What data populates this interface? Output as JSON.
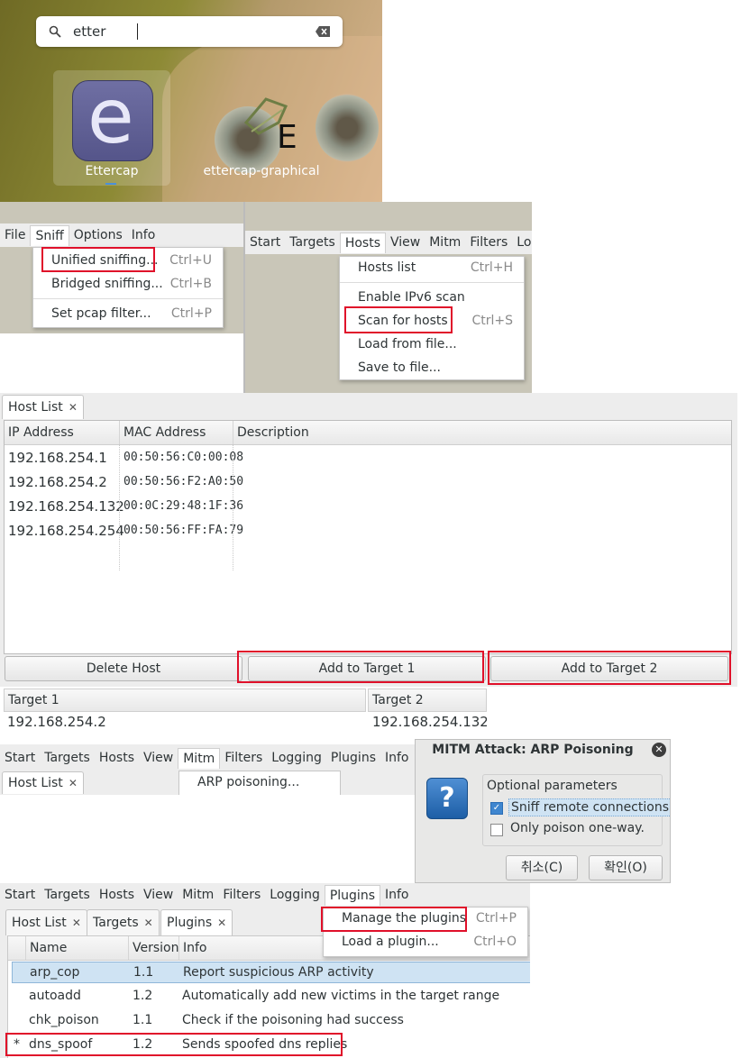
{
  "launcher": {
    "search_value": "etter",
    "apps": [
      {
        "label": "Ettercap",
        "icon": "ettercap-e-icon"
      },
      {
        "label": "ettercap-graphical",
        "icon": "terminal-cursor-icon"
      }
    ]
  },
  "sniff_panel": {
    "menubar": [
      "File",
      "Sniff",
      "Options",
      "Info"
    ],
    "items": [
      {
        "label": "Unified sniffing...",
        "accel": "Ctrl+U"
      },
      {
        "label": "Bridged sniffing...",
        "accel": "Ctrl+B"
      },
      {
        "label": "Set pcap filter...",
        "accel": "Ctrl+P"
      }
    ]
  },
  "hosts_panel": {
    "menubar": [
      "Start",
      "Targets",
      "Hosts",
      "View",
      "Mitm",
      "Filters",
      "Lo"
    ],
    "items": [
      {
        "label": "Hosts list",
        "accel": "Ctrl+H"
      },
      {
        "label": "Enable IPv6 scan",
        "accel": ""
      },
      {
        "label": "Scan for hosts",
        "accel": "Ctrl+S"
      },
      {
        "label": "Load from file...",
        "accel": ""
      },
      {
        "label": "Save to file...",
        "accel": ""
      }
    ]
  },
  "host_list": {
    "tab": "Host List",
    "columns": [
      "IP Address",
      "MAC Address",
      "Description"
    ],
    "rows": [
      {
        "ip": "192.168.254.1",
        "mac": "00:50:56:C0:00:08"
      },
      {
        "ip": "192.168.254.2",
        "mac": "00:50:56:F2:A0:50"
      },
      {
        "ip": "192.168.254.132",
        "mac": "00:0C:29:48:1F:36"
      },
      {
        "ip": "192.168.254.254",
        "mac": "00:50:56:FF:FA:79"
      }
    ],
    "buttons": {
      "delete": "Delete Host",
      "target1": "Add to Target 1",
      "target2": "Add to Target 2"
    }
  },
  "targets": {
    "target1_label": "Target 1",
    "target1_value": "192.168.254.2",
    "target2_label": "Target 2",
    "target2_value": "192.168.254.132"
  },
  "mitm_panel": {
    "menubar": [
      "Start",
      "Targets",
      "Hosts",
      "View",
      "Mitm",
      "Filters",
      "Logging",
      "Plugins",
      "Info"
    ],
    "tab": "Host List",
    "item": "ARP poisoning..."
  },
  "arp_dialog": {
    "title": "MITM Attack: ARP Poisoning",
    "group_label": "Optional parameters",
    "opt1": "Sniff remote connections.",
    "opt1_checked": true,
    "opt2": "Only poison one-way.",
    "opt2_checked": false,
    "cancel": "취소(C)",
    "ok": "확인(O)"
  },
  "plugins_panel": {
    "menubar": [
      "Start",
      "Targets",
      "Hosts",
      "View",
      "Mitm",
      "Filters",
      "Logging",
      "Plugins",
      "Info"
    ],
    "tabs": [
      "Host List",
      "Targets",
      "Plugins"
    ],
    "menu_items": [
      {
        "label": "Manage the plugins",
        "accel": "Ctrl+P"
      },
      {
        "label": "Load a plugin...",
        "accel": "Ctrl+O"
      }
    ],
    "columns": [
      "Name",
      "Version",
      "Info"
    ],
    "rows": [
      {
        "mark": "",
        "name": "arp_cop",
        "version": "1.1",
        "info": "Report suspicious ARP activity"
      },
      {
        "mark": "",
        "name": "autoadd",
        "version": "1.2",
        "info": "Automatically add new victims in the target range"
      },
      {
        "mark": "",
        "name": "chk_poison",
        "version": "1.1",
        "info": "Check if the poisoning had success"
      },
      {
        "mark": "*",
        "name": "dns_spoof",
        "version": "1.2",
        "info": "Sends spoofed dns replies"
      }
    ]
  },
  "colors": {
    "highlight": "#e0102a",
    "selection": "#cfe3f3",
    "menu_bg": "#ededed"
  }
}
